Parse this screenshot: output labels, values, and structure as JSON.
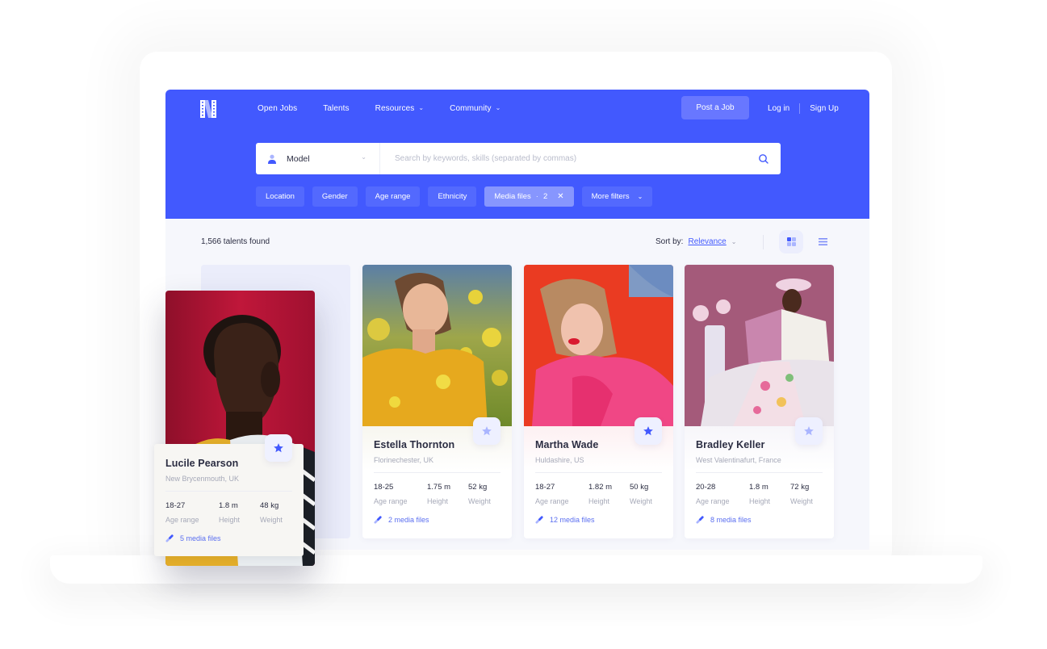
{
  "brand": {
    "logo": "N",
    "primary_color": "#4259fe",
    "chip_color": "#5369fe",
    "active_chip_color": "#8796fe"
  },
  "nav": {
    "items": [
      {
        "label": "Open Jobs",
        "has_dropdown": false
      },
      {
        "label": "Talents",
        "has_dropdown": false
      },
      {
        "label": "Resources",
        "has_dropdown": true
      },
      {
        "label": "Community",
        "has_dropdown": true
      }
    ],
    "post_job": "Post a Job",
    "login": "Log in",
    "signup": "Sign Up"
  },
  "search": {
    "category": "Model",
    "category_icon": "person-icon",
    "placeholder": "Search by keywords, skills (separated by commas)",
    "value": "",
    "submit_icon": "search-icon"
  },
  "filters": [
    {
      "label": "Location",
      "active": false
    },
    {
      "label": "Gender",
      "active": false
    },
    {
      "label": "Age range",
      "active": false
    },
    {
      "label": "Ethnicity",
      "active": false
    },
    {
      "label": "Media files",
      "active": true,
      "count": "2"
    },
    {
      "label": "More filters",
      "active": false,
      "dropdown": true
    }
  ],
  "results": {
    "count_text": "1,566 talents found",
    "sort_label": "Sort by:",
    "sort_value": "Relevance",
    "view_modes": [
      "grid-view-icon",
      "list-view-icon"
    ],
    "active_view": "grid"
  },
  "talents": [
    {
      "name": "Lucile Pearson",
      "location": "New Brycenmouth, UK",
      "age_range": "18-27",
      "height": "1.8 m",
      "weight": "48 kg",
      "media": "5 media files",
      "favorited": true
    },
    {
      "name": "Estella Thornton",
      "location": "Florinechester, UK",
      "age_range": "18-25",
      "height": "1.75 m",
      "weight": "52 kg",
      "media": "2 media files",
      "favorited": false
    },
    {
      "name": "Martha Wade",
      "location": "Huldashire, US",
      "age_range": "18-27",
      "height": "1.82 m",
      "weight": "50 kg",
      "media": "12 media files",
      "favorited": true
    },
    {
      "name": "Bradley Keller",
      "location": "West Valentinafurt, France",
      "age_range": "20-28",
      "height": "1.8 m",
      "weight": "72 kg",
      "media": "8 media files",
      "favorited": false
    }
  ],
  "labels": {
    "age_range": "Age range",
    "height": "Height",
    "weight": "Weight"
  }
}
